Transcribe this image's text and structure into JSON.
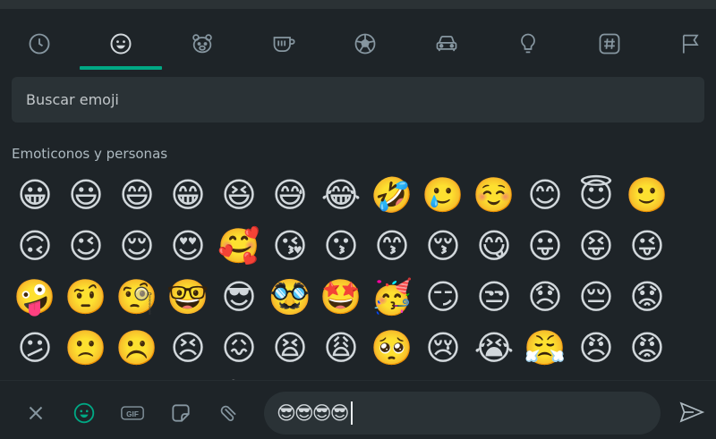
{
  "picker": {
    "categories": [
      {
        "name": "recent",
        "icon": "clock-icon"
      },
      {
        "name": "smileys",
        "icon": "smiley-icon",
        "selected": true
      },
      {
        "name": "animals",
        "icon": "bear-icon"
      },
      {
        "name": "food",
        "icon": "cup-icon"
      },
      {
        "name": "activity",
        "icon": "soccer-ball-icon"
      },
      {
        "name": "travel",
        "icon": "car-icon"
      },
      {
        "name": "objects",
        "icon": "lightbulb-icon"
      },
      {
        "name": "symbols",
        "icon": "hashtag-icon"
      },
      {
        "name": "flags",
        "icon": "flag-icon"
      }
    ],
    "search_placeholder": "Buscar emoji",
    "section_title": "Emoticonos y personas",
    "rows": [
      [
        "😀",
        "😃",
        "😄",
        "😁",
        "😆",
        "😅",
        "😂",
        "🤣",
        "🥲",
        "☺️",
        "😊",
        "😇",
        "🙂"
      ],
      [
        "🙃",
        "😉",
        "😌",
        "😍",
        "🥰",
        "😘",
        "😗",
        "😙",
        "😚",
        "😋",
        "😛",
        "😝",
        "😜"
      ],
      [
        "🤪",
        "🤨",
        "🧐",
        "🤓",
        "😎",
        "🥸",
        "🤩",
        "🥳",
        "😏",
        "😒",
        "😞",
        "😔",
        "😟"
      ],
      [
        "😕",
        "🙁",
        "☹️",
        "😣",
        "😖",
        "😫",
        "😩",
        "🥺",
        "😢",
        "😭",
        "😤",
        "😠",
        "😡"
      ],
      [
        "🤬",
        "🤯",
        "😳",
        "🥵",
        "🥶",
        "😱",
        "😨",
        "😰",
        "😥",
        "😓",
        "🤗",
        "🤔",
        "🤭"
      ]
    ]
  },
  "composer": {
    "message_text": "😎😎😎😎",
    "accent_color": "#00a884",
    "buttons": [
      {
        "name": "close-button",
        "icon": "close-icon"
      },
      {
        "name": "emoji-button",
        "icon": "smiley-icon",
        "active": true
      },
      {
        "name": "gif-button",
        "icon": "gif-icon",
        "label": "GIF"
      },
      {
        "name": "sticker-button",
        "icon": "sticker-icon"
      },
      {
        "name": "attach-button",
        "icon": "paperclip-icon"
      },
      {
        "name": "send-button",
        "icon": "send-icon"
      }
    ]
  }
}
